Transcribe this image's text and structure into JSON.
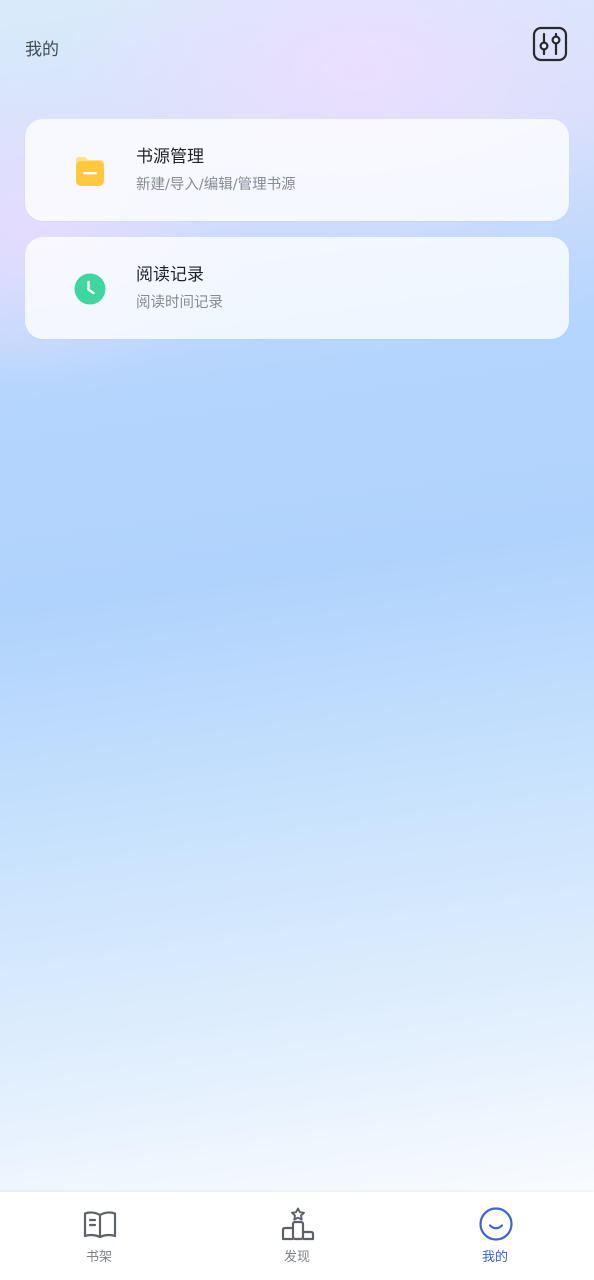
{
  "header": {
    "title": "我的",
    "settings_icon": "sliders-icon"
  },
  "menu": [
    {
      "title": "书源管理",
      "subtitle": "新建/导入/编辑/管理书源",
      "icon": "folder-icon",
      "icon_color": "#FFC83D"
    },
    {
      "title": "阅读记录",
      "subtitle": "阅读时间记录",
      "icon": "clock-icon",
      "icon_color": "#3FD6A0"
    }
  ],
  "tabbar": {
    "tabs": [
      {
        "label": "书架",
        "icon": "book-icon",
        "active": false
      },
      {
        "label": "发现",
        "icon": "podium-icon",
        "active": false
      },
      {
        "label": "我的",
        "icon": "smile-icon",
        "active": true
      }
    ],
    "active_color": "#3A63D8",
    "inactive_color": "#7D8187"
  }
}
